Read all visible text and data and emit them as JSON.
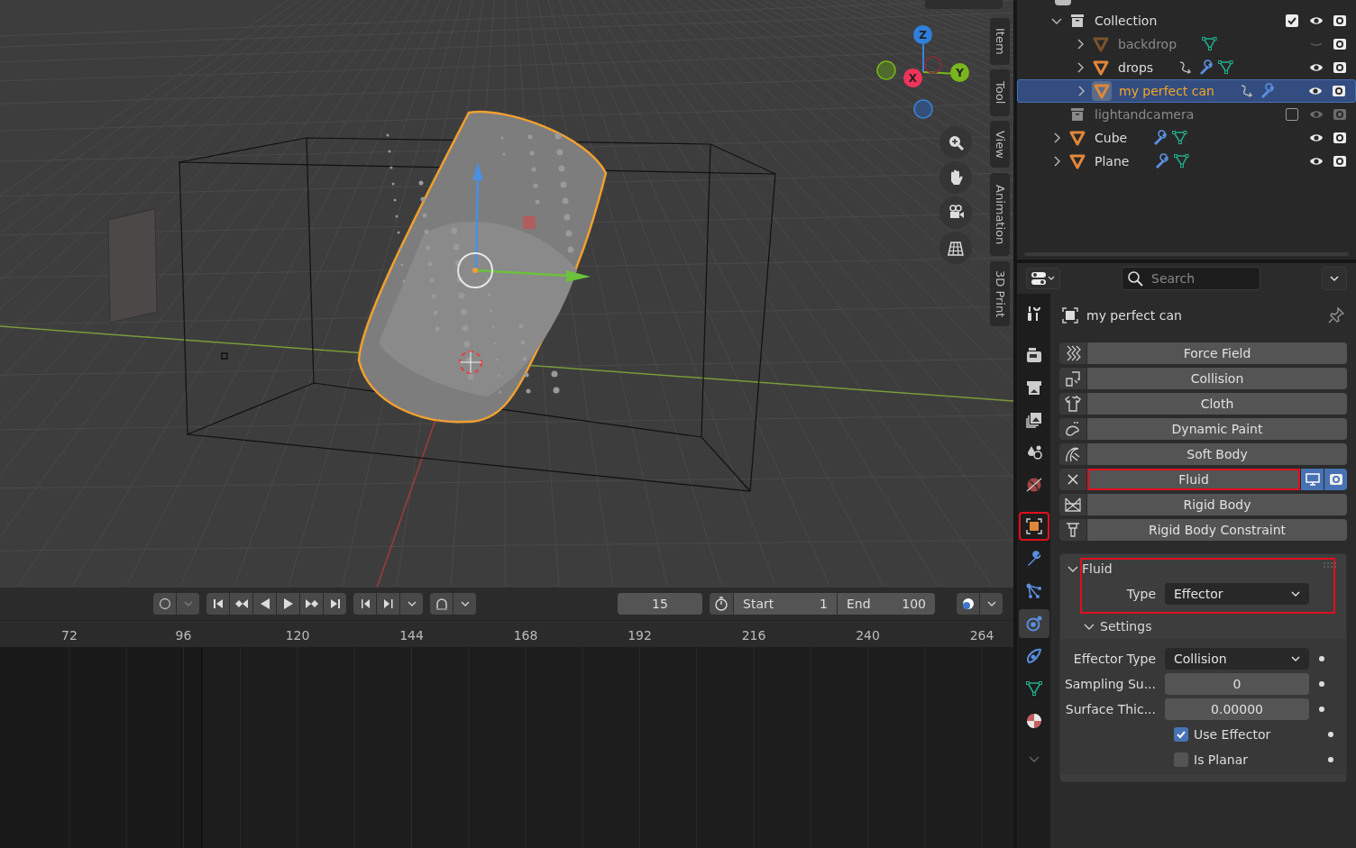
{
  "viewport": {
    "gizmo_axes": [
      "Z",
      "X",
      "Y"
    ],
    "side_tabs": [
      "Item",
      "Tool",
      "View",
      "Animation",
      "3D Print"
    ]
  },
  "timeline": {
    "frame": "15",
    "start_label": "Start",
    "start": "1",
    "end_label": "End",
    "end": "100",
    "ruler": [
      "72",
      "96",
      "120",
      "144",
      "168",
      "192",
      "216",
      "240",
      "264"
    ]
  },
  "outliner": {
    "items": [
      {
        "kind": "collection",
        "name": "Collection",
        "expanded": true,
        "checked": true,
        "visible": true,
        "children": [
          {
            "kind": "object",
            "name": "backdrop",
            "selected": false,
            "visible": false,
            "has_constraint": false,
            "has_modifier": false,
            "has_mesh": true
          },
          {
            "kind": "object",
            "name": "drops",
            "selected": false,
            "visible": true,
            "has_constraint": true,
            "has_modifier": true,
            "has_mesh": true
          },
          {
            "kind": "object",
            "name": "my perfect can",
            "selected": true,
            "visible": true,
            "has_constraint": true,
            "has_modifier": true,
            "has_mesh": false
          }
        ]
      },
      {
        "kind": "collection",
        "name": "lightandcamera",
        "checked": false,
        "visible": false
      },
      {
        "kind": "object",
        "name": "Cube",
        "selected": false,
        "visible": true,
        "has_constraint": false,
        "has_modifier": true,
        "has_mesh": true
      },
      {
        "kind": "object",
        "name": "Plane",
        "selected": false,
        "visible": true,
        "has_constraint": false,
        "has_modifier": true,
        "has_mesh": true
      }
    ]
  },
  "properties": {
    "search_placeholder": "Search",
    "object_name": "my perfect can",
    "tabs": [
      {
        "kind": "tool",
        "selected": false,
        "highlighted": false
      },
      {
        "kind": "render",
        "selected": false,
        "highlighted": false
      },
      {
        "kind": "output",
        "selected": false,
        "highlighted": false
      },
      {
        "kind": "view_layer",
        "selected": false,
        "highlighted": false
      },
      {
        "kind": "scene",
        "selected": false,
        "highlighted": false
      },
      {
        "kind": "world",
        "selected": false,
        "highlighted": false
      },
      {
        "kind": "object",
        "selected": false,
        "highlighted": true
      },
      {
        "kind": "modifiers",
        "selected": false,
        "highlighted": false
      },
      {
        "kind": "particles",
        "selected": false,
        "highlighted": false
      },
      {
        "kind": "physics",
        "selected": true,
        "highlighted": false
      },
      {
        "kind": "constraints",
        "selected": false,
        "highlighted": false
      },
      {
        "kind": "data",
        "selected": false,
        "highlighted": false
      },
      {
        "kind": "material",
        "selected": false,
        "highlighted": false
      }
    ],
    "physics": [
      {
        "kind": "force_field",
        "label": "Force Field",
        "enabled": false,
        "highlighted": false
      },
      {
        "kind": "collision",
        "label": "Collision",
        "enabled": false,
        "highlighted": false
      },
      {
        "kind": "cloth",
        "label": "Cloth",
        "enabled": false,
        "highlighted": false
      },
      {
        "kind": "dynamic_paint",
        "label": "Dynamic Paint",
        "enabled": false,
        "highlighted": false
      },
      {
        "kind": "soft_body",
        "label": "Soft Body",
        "enabled": false,
        "highlighted": false
      },
      {
        "kind": "fluid",
        "label": "Fluid",
        "enabled": true,
        "highlighted": true
      },
      {
        "kind": "rigid_body",
        "label": "Rigid Body",
        "enabled": false,
        "highlighted": false
      },
      {
        "kind": "rigid_body_constraint",
        "label": "Rigid Body Constraint",
        "enabled": false,
        "highlighted": false
      }
    ],
    "fluid_panel": {
      "title": "Fluid",
      "expanded": true,
      "highlighted": true,
      "type_label": "Type",
      "type_value": "Effector",
      "settings": {
        "title": "Settings",
        "expanded": true,
        "fields": [
          {
            "kind": "dropdown",
            "label": "Effector Type",
            "value": "Collision"
          },
          {
            "kind": "number",
            "label": "Sampling Su...",
            "value": "0"
          },
          {
            "kind": "number",
            "label": "Surface Thic...",
            "value": "0.00000"
          },
          {
            "kind": "checkbox",
            "label": "Use Effector",
            "checked": true
          },
          {
            "kind": "checkbox",
            "label": "Is Planar",
            "checked": false
          }
        ]
      }
    }
  }
}
